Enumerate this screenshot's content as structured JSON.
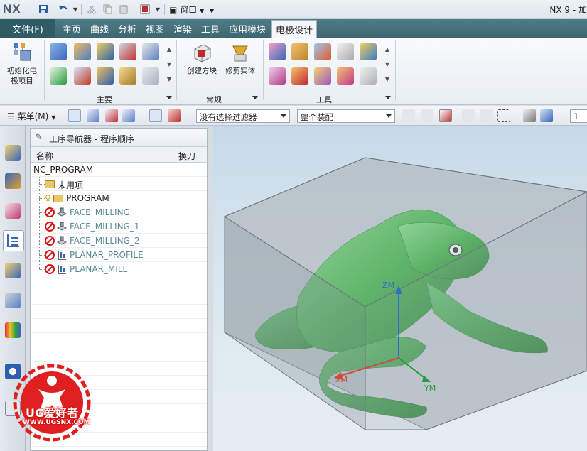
{
  "titlebar": {
    "logo": "NX",
    "window_menu": "窗口",
    "app_title": "NX 9 - 加"
  },
  "tabs": {
    "file": "文件(F)",
    "items": [
      "主页",
      "曲线",
      "分析",
      "视图",
      "渲染",
      "工具",
      "应用模块",
      "电极设计"
    ],
    "active": "电极设计"
  },
  "ribbon": {
    "init_button": "初始化电极项目",
    "groups": [
      {
        "label": "主要"
      },
      {
        "label": "常规",
        "buttons": [
          "创建方块",
          "修剪实体"
        ]
      },
      {
        "label": "工具"
      }
    ]
  },
  "cmdbar": {
    "menu_label": "菜单(M)",
    "filter_value": "没有选择过滤器",
    "assembly_value": "整个装配",
    "count_value": "1"
  },
  "navigator": {
    "title": "工序导航器 - 程序顺序",
    "columns": [
      "名称",
      "换刀"
    ],
    "rows": [
      {
        "label": "NC_PROGRAM",
        "level": 0,
        "icon": "none",
        "status": "ok"
      },
      {
        "label": "未用项",
        "level": 1,
        "icon": "folder",
        "status": "ok"
      },
      {
        "label": "PROGRAM",
        "level": 1,
        "icon": "folder-key",
        "status": "ok"
      },
      {
        "label": "FACE_MILLING",
        "level": 1,
        "icon": "face-mill",
        "status": "error"
      },
      {
        "label": "FACE_MILLING_1",
        "level": 1,
        "icon": "face-mill",
        "status": "error"
      },
      {
        "label": "FACE_MILLING_2",
        "level": 1,
        "icon": "face-mill",
        "status": "error"
      },
      {
        "label": "PLANAR_PROFILE",
        "level": 1,
        "icon": "planar",
        "status": "error"
      },
      {
        "label": "PLANAR_MILL",
        "level": 1,
        "icon": "planar",
        "status": "error"
      }
    ]
  },
  "viewport": {
    "axes": {
      "z": "ZM",
      "y": "YM",
      "x": "XM"
    },
    "colors": {
      "model": "#3fae4a",
      "block": "#9aa3ab",
      "z_axis": "#2c6fcc",
      "y_axis": "#2a9a3a",
      "x_axis": "#d24a3a"
    }
  },
  "watermark": {
    "brand": "UG爱好者",
    "url": "WWW.UGSNX.COM"
  }
}
